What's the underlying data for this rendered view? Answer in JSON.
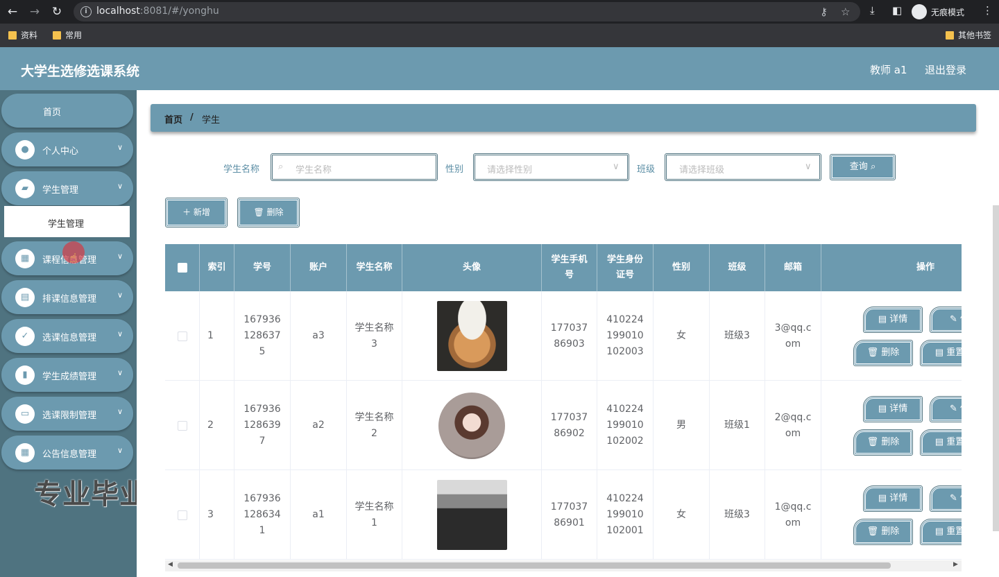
{
  "browser": {
    "url_host": "localhost",
    "url_rest": ":8081/#/yonghu",
    "incognito_label": "无痕模式",
    "bookmarks": [
      "资料",
      "常用"
    ],
    "other_bookmarks": "其他书签"
  },
  "header": {
    "title": "大学生选修选课系统",
    "user": "教师 a1",
    "logout": "退出登录"
  },
  "sidebar": {
    "home": "首页",
    "items": [
      {
        "label": "个人中心",
        "icon": "user-icon"
      },
      {
        "label": "学生管理",
        "icon": "wallet-icon"
      },
      {
        "label": "课程信息管理",
        "icon": "grid-icon"
      },
      {
        "label": "排课信息管理",
        "icon": "clipboard-icon"
      },
      {
        "label": "选课信息管理",
        "icon": "clipboard-check-icon"
      },
      {
        "label": "学生成绩管理",
        "icon": "bar-chart-icon"
      },
      {
        "label": "选课限制管理",
        "icon": "monitor-icon"
      },
      {
        "label": "公告信息管理",
        "icon": "grid-icon"
      }
    ],
    "submenu_active": "学生管理"
  },
  "watermark": "专业毕业设计代做",
  "breadcrumb": {
    "home": "首页",
    "sep": "/",
    "current": "学生"
  },
  "filters": {
    "name_label": "学生名称",
    "name_placeholder": "学生名称",
    "gender_label": "性别",
    "gender_placeholder": "请选择性别",
    "class_label": "班级",
    "class_placeholder": "请选择班级",
    "query_button": "查询"
  },
  "actions": {
    "add": "新增",
    "delete": "删除"
  },
  "table": {
    "headers": [
      "索引",
      "学号",
      "账户",
      "学生名称",
      "头像",
      "学生手机号",
      "学生身份证号",
      "性别",
      "班级",
      "邮箱",
      "操作"
    ],
    "rows": [
      {
        "index": "1",
        "student_no": "1679361286375",
        "account": "a3",
        "name": "学生名称3",
        "phone": "17703786903",
        "id_card": "410224199010102003",
        "gender": "女",
        "class": "班级3",
        "email": "3@qq.com"
      },
      {
        "index": "2",
        "student_no": "1679361286397",
        "account": "a2",
        "name": "学生名称2",
        "phone": "17703786902",
        "id_card": "410224199010102002",
        "gender": "男",
        "class": "班级1",
        "email": "2@qq.com"
      },
      {
        "index": "3",
        "student_no": "1679361286341",
        "account": "a1",
        "name": "学生名称1",
        "phone": "17703786901",
        "id_card": "410224199010102001",
        "gender": "女",
        "class": "班级3",
        "email": "1@qq.com"
      }
    ],
    "row_buttons": {
      "detail": "详情",
      "edit": "修",
      "delete": "删除",
      "reset": "重置"
    }
  }
}
